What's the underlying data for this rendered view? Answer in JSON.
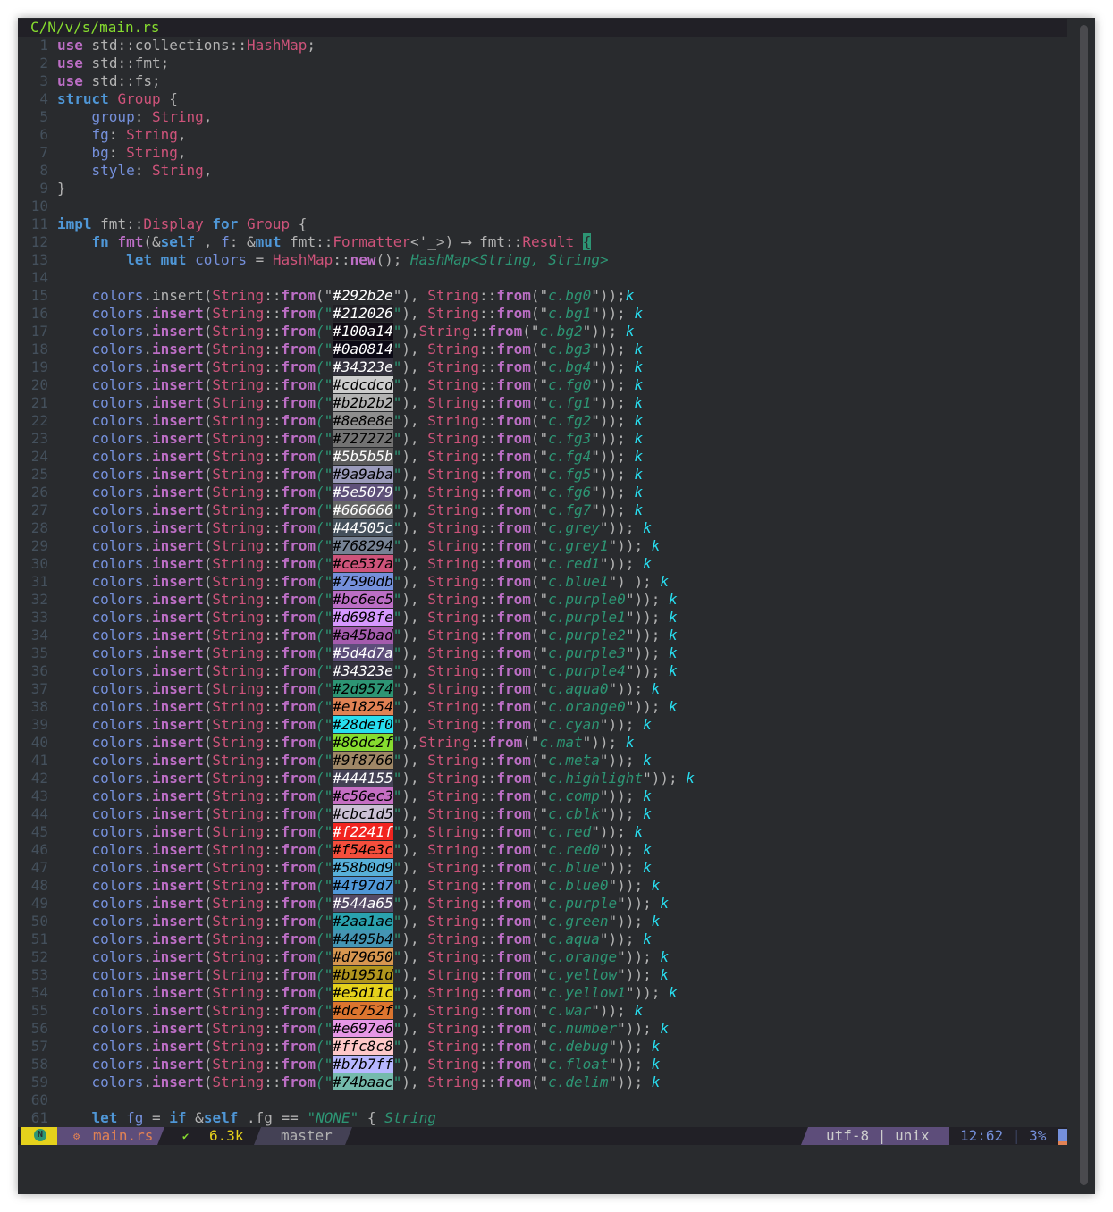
{
  "editor": {
    "tab_path": "C/N/v/s/main.rs",
    "lines": [
      {
        "n": "1",
        "t": [
          [
            "kw2",
            "use"
          ],
          [
            "",
            "std"
          ],
          [
            "ns",
            "::"
          ],
          [
            "",
            "collections"
          ],
          [
            "ns",
            "::"
          ],
          [
            "ty",
            "HashMap"
          ],
          [
            "",
            ";"
          ]
        ]
      },
      {
        "n": "2",
        "t": [
          [
            "kw2",
            "use"
          ],
          [
            "",
            "std"
          ],
          [
            "ns",
            "::"
          ],
          [
            "",
            "fmt"
          ],
          [
            "",
            ";"
          ]
        ]
      },
      {
        "n": "3",
        "t": [
          [
            "kw2",
            "use"
          ],
          [
            "",
            "std"
          ],
          [
            "ns",
            "::"
          ],
          [
            "",
            "fs"
          ],
          [
            "",
            ";"
          ]
        ]
      },
      {
        "n": "4",
        "t": [
          [
            "kw",
            "struct"
          ],
          [
            "ty",
            "Group"
          ],
          [
            "",
            "{"
          ]
        ]
      },
      {
        "n": "5",
        "t": [
          [
            "fld",
            "group"
          ],
          [
            "",
            ":"
          ],
          [
            "ty",
            "String"
          ],
          [
            "",
            ","
          ]
        ]
      },
      {
        "n": "6",
        "t": [
          [
            "fld",
            "fg"
          ],
          [
            "",
            ":"
          ],
          [
            "ty",
            "String"
          ],
          [
            "",
            ","
          ]
        ]
      },
      {
        "n": "7",
        "t": [
          [
            "fld",
            "bg"
          ],
          [
            "",
            ":"
          ],
          [
            "ty",
            "String"
          ],
          [
            "",
            ","
          ]
        ]
      },
      {
        "n": "8",
        "t": [
          [
            "fld",
            "style"
          ],
          [
            "",
            ":"
          ],
          [
            "ty",
            "String"
          ],
          [
            "",
            ","
          ]
        ]
      },
      {
        "n": "9",
        "t": [
          [
            "",
            "}"
          ]
        ]
      },
      {
        "n": "10",
        "t": []
      },
      {
        "n": "11",
        "t": [
          [
            "kw",
            "impl"
          ],
          [
            "",
            "fmt"
          ],
          [
            "ns",
            "::"
          ],
          [
            "ty",
            "Display"
          ],
          [
            "kw",
            "for"
          ],
          [
            "ty",
            "Group"
          ],
          [
            "",
            "{"
          ]
        ]
      },
      {
        "n": "12",
        "t": [
          [
            "kw",
            "fn"
          ],
          [
            "fn",
            "fmt"
          ],
          [
            "",
            "(&"
          ],
          [
            "kw",
            "self"
          ],
          [
            "",
            ","
          ],
          [
            "fld",
            "f"
          ],
          [
            "",
            ":"
          ],
          [
            "",
            "&"
          ],
          [
            "kw",
            "mut"
          ],
          [
            "",
            "fmt"
          ],
          [
            "ns",
            "::"
          ],
          [
            "ty",
            "Formatter"
          ],
          [
            "",
            "<'_>)"
          ],
          [
            "",
            "⟶"
          ],
          [
            "",
            "fmt"
          ],
          [
            "ns",
            "::"
          ],
          [
            "ty",
            "Result"
          ],
          [
            "cursor",
            "{"
          ]
        ]
      },
      {
        "n": "13",
        "t": [
          [
            "kw",
            "let"
          ],
          [
            "kw",
            "mut"
          ],
          [
            "fld",
            "colors"
          ],
          [
            "",
            "="
          ],
          [
            "ty",
            "HashMap"
          ],
          [
            "ns",
            "::"
          ],
          [
            "fn",
            "new"
          ],
          [
            "",
            "();"
          ],
          [
            "hint",
            "HashMap<String, String>"
          ]
        ]
      },
      {
        "n": "14",
        "t": []
      },
      {
        "n": "15",
        "t": [
          [
            "fld",
            "colors"
          ],
          [
            "",
            ".insert("
          ],
          [
            "ty",
            "String"
          ],
          [
            "ns",
            "::"
          ],
          [
            "fn",
            "from"
          ],
          [
            "",
            "(\""
          ],
          [
            "sw",
            "#292b2e"
          ],
          [
            "",
            "\"),"
          ],
          [
            "ty",
            "String"
          ],
          [
            "ns",
            "::"
          ],
          [
            "fn",
            "from"
          ],
          [
            "",
            "(\""
          ],
          [
            "strc",
            "c.bg0"
          ],
          [
            "",
            "\"));"
          ],
          [
            "kvar",
            "k"
          ]
        ]
      },
      {
        "n": "16",
        "sw": "#212026",
        "name": "c.bg1"
      },
      {
        "n": "17",
        "sw": "#100a14",
        "name": "c.bg2",
        "tight": true
      },
      {
        "n": "18",
        "sw": "#0a0814",
        "name": "c.bg3"
      },
      {
        "n": "19",
        "sw": "#34323e",
        "name": "c.bg4"
      },
      {
        "n": "20",
        "sw": "#cdcdcd",
        "name": "c.fg0"
      },
      {
        "n": "21",
        "sw": "#b2b2b2",
        "name": "c.fg1"
      },
      {
        "n": "22",
        "sw": "#8e8e8e",
        "name": "c.fg2"
      },
      {
        "n": "23",
        "sw": "#727272",
        "name": "c.fg3"
      },
      {
        "n": "24",
        "sw": "#5b5b5b",
        "name": "c.fg4"
      },
      {
        "n": "25",
        "sw": "#9a9aba",
        "name": "c.fg5"
      },
      {
        "n": "26",
        "sw": "#5e5079",
        "name": "c.fg6"
      },
      {
        "n": "27",
        "sw": "#666666",
        "name": "c.fg7"
      },
      {
        "n": "28",
        "sw": "#44505c",
        "name": "c.grey"
      },
      {
        "n": "29",
        "sw": "#768294",
        "name": "c.grey1"
      },
      {
        "n": "30",
        "sw": "#ce537a",
        "name": "c.red1"
      },
      {
        "n": "31",
        "sw": "#7590db",
        "name": "c.blue1",
        "extra": " "
      },
      {
        "n": "32",
        "sw": "#bc6ec5",
        "name": "c.purple0"
      },
      {
        "n": "33",
        "sw": "#d698fe",
        "name": "c.purple1"
      },
      {
        "n": "34",
        "sw": "#a45bad",
        "name": "c.purple2"
      },
      {
        "n": "35",
        "sw": "#5d4d7a",
        "name": "c.purple3"
      },
      {
        "n": "36",
        "sw": "#34323e",
        "name": "c.purple4"
      },
      {
        "n": "37",
        "sw": "#2d9574",
        "name": "c.aqua0"
      },
      {
        "n": "38",
        "sw": "#e18254",
        "name": "c.orange0"
      },
      {
        "n": "39",
        "sw": "#28def0",
        "name": "c.cyan"
      },
      {
        "n": "40",
        "sw": "#86dc2f",
        "name": "c.mat",
        "tight": true
      },
      {
        "n": "41",
        "sw": "#9f8766",
        "name": "c.meta"
      },
      {
        "n": "42",
        "sw": "#444155",
        "name": "c.highlight"
      },
      {
        "n": "43",
        "sw": "#c56ec3",
        "name": "c.comp"
      },
      {
        "n": "44",
        "sw": "#cbc1d5",
        "name": "c.cblk"
      },
      {
        "n": "45",
        "sw": "#f2241f",
        "name": "c.red"
      },
      {
        "n": "46",
        "sw": "#f54e3c",
        "name": "c.red0"
      },
      {
        "n": "47",
        "sw": "#58b0d9",
        "name": "c.blue"
      },
      {
        "n": "48",
        "sw": "#4f97d7",
        "name": "c.blue0"
      },
      {
        "n": "49",
        "sw": "#544a65",
        "name": "c.purple"
      },
      {
        "n": "50",
        "sw": "#2aa1ae",
        "name": "c.green"
      },
      {
        "n": "51",
        "sw": "#4495b4",
        "name": "c.aqua"
      },
      {
        "n": "52",
        "sw": "#d79650",
        "name": "c.orange"
      },
      {
        "n": "53",
        "sw": "#b1951d",
        "name": "c.yellow"
      },
      {
        "n": "54",
        "sw": "#e5d11c",
        "name": "c.yellow1"
      },
      {
        "n": "55",
        "sw": "#dc752f",
        "name": "c.war"
      },
      {
        "n": "56",
        "sw": "#e697e6",
        "name": "c.number"
      },
      {
        "n": "57",
        "sw": "#ffc8c8",
        "name": "c.debug"
      },
      {
        "n": "58",
        "sw": "#b7b7ff",
        "name": "c.float"
      },
      {
        "n": "59",
        "sw": "#74baac",
        "name": "c.delim"
      },
      {
        "n": "60",
        "t": []
      },
      {
        "n": "61",
        "t": [
          [
            "kw",
            "let"
          ],
          [
            "fld",
            "fg"
          ],
          [
            "",
            "="
          ],
          [
            "kw",
            "if"
          ],
          [
            "",
            "&"
          ],
          [
            "kw",
            "self"
          ],
          [
            "",
            ".fg"
          ],
          [
            "",
            "=="
          ],
          [
            "str",
            "\"NONE\""
          ],
          [
            "",
            "{"
          ],
          [
            "hint",
            "String"
          ]
        ]
      }
    ]
  },
  "statusline": {
    "mode_letter": "N",
    "filetype_icon": "rust-file-icon",
    "filename": "main.rs",
    "check_icon": "check-icon",
    "size": "6.3k",
    "branch": "master",
    "encoding": "utf-8 | unix",
    "position": "12:62 | 3%"
  },
  "colors": {
    "bg": "#292b2e",
    "keyword": "#4f97d7",
    "type": "#ce537a",
    "function": "#bc6ec5",
    "string": "#2d9574",
    "mode": "#e5d11c"
  }
}
